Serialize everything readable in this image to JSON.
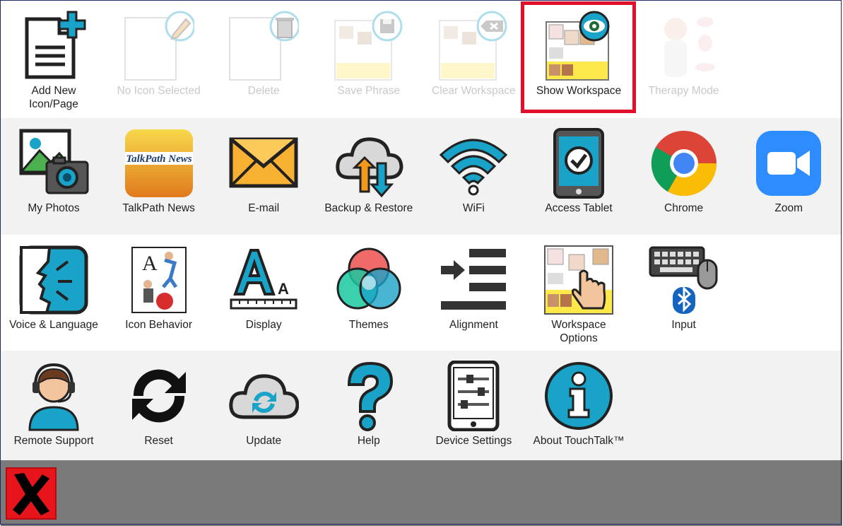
{
  "rows": [
    [
      {
        "id": "add-new",
        "label": "Add New\nIcon/Page",
        "icon": "add-page-icon",
        "enabled": true
      },
      {
        "id": "no-icon-selected",
        "label": "No Icon Selected",
        "icon": "edit-pencil-icon",
        "enabled": false
      },
      {
        "id": "delete",
        "label": "Delete",
        "icon": "trash-icon",
        "enabled": false
      },
      {
        "id": "save-phrase",
        "label": "Save Phrase",
        "icon": "save-disk-icon",
        "enabled": false
      },
      {
        "id": "clear-workspace",
        "label": "Clear Workspace",
        "icon": "clear-workspace-icon",
        "enabled": false
      },
      {
        "id": "show-workspace",
        "label": "Show Workspace",
        "icon": "show-workspace-eye-icon",
        "enabled": true
      },
      {
        "id": "therapy-mode",
        "label": "Therapy Mode",
        "icon": "therapy-mode-icon",
        "enabled": false
      }
    ],
    [
      {
        "id": "my-photos",
        "label": "My Photos",
        "icon": "photos-camera-icon",
        "enabled": true
      },
      {
        "id": "talkpath-news",
        "label": "TalkPath News",
        "icon": "talkpath-news-icon",
        "enabled": true
      },
      {
        "id": "email",
        "label": "E-mail",
        "icon": "envelope-icon",
        "enabled": true
      },
      {
        "id": "backup-restore",
        "label": "Backup & Restore",
        "icon": "cloud-sync-icon",
        "enabled": true
      },
      {
        "id": "wifi",
        "label": "WiFi",
        "icon": "wifi-icon",
        "enabled": true
      },
      {
        "id": "access-tablet",
        "label": "Access Tablet",
        "icon": "tablet-check-icon",
        "enabled": true
      },
      {
        "id": "chrome",
        "label": "Chrome",
        "icon": "chrome-icon",
        "enabled": true
      },
      {
        "id": "zoom",
        "label": "Zoom",
        "icon": "zoom-video-icon",
        "enabled": true
      }
    ],
    [
      {
        "id": "voice-language",
        "label": "Voice & Language",
        "icon": "voice-speaking-icon",
        "enabled": true
      },
      {
        "id": "icon-behavior",
        "label": "Icon Behavior",
        "icon": "icon-behavior-icon",
        "enabled": true
      },
      {
        "id": "display",
        "label": "Display",
        "icon": "display-font-size-icon",
        "enabled": true
      },
      {
        "id": "themes",
        "label": "Themes",
        "icon": "themes-color-circles-icon",
        "enabled": true
      },
      {
        "id": "alignment",
        "label": "Alignment",
        "icon": "alignment-icon",
        "enabled": true
      },
      {
        "id": "workspace-options",
        "label": "Workspace\nOptions",
        "icon": "workspace-options-hand-icon",
        "enabled": true
      },
      {
        "id": "input",
        "label": "Input",
        "icon": "keyboard-mouse-bluetooth-icon",
        "enabled": true
      }
    ],
    [
      {
        "id": "remote-support",
        "label": "Remote Support",
        "icon": "headset-support-icon",
        "enabled": true
      },
      {
        "id": "reset",
        "label": "Reset",
        "icon": "reset-arrows-icon",
        "enabled": true
      },
      {
        "id": "update",
        "label": "Update",
        "icon": "cloud-update-icon",
        "enabled": true
      },
      {
        "id": "help",
        "label": "Help",
        "icon": "question-mark-icon",
        "enabled": true
      },
      {
        "id": "device-settings",
        "label": "Device Settings",
        "icon": "device-settings-sliders-icon",
        "enabled": true
      },
      {
        "id": "about",
        "label": "About TouchTalk™",
        "icon": "info-icon",
        "enabled": true
      }
    ]
  ],
  "highlighted": "show-workspace",
  "close_button": {
    "icon": "close-x-icon"
  },
  "colors": {
    "accent": "#1aa3c8",
    "highlight": "#e0102a",
    "close": "#e8141b",
    "bottom_bar": "#7a7a7a"
  }
}
